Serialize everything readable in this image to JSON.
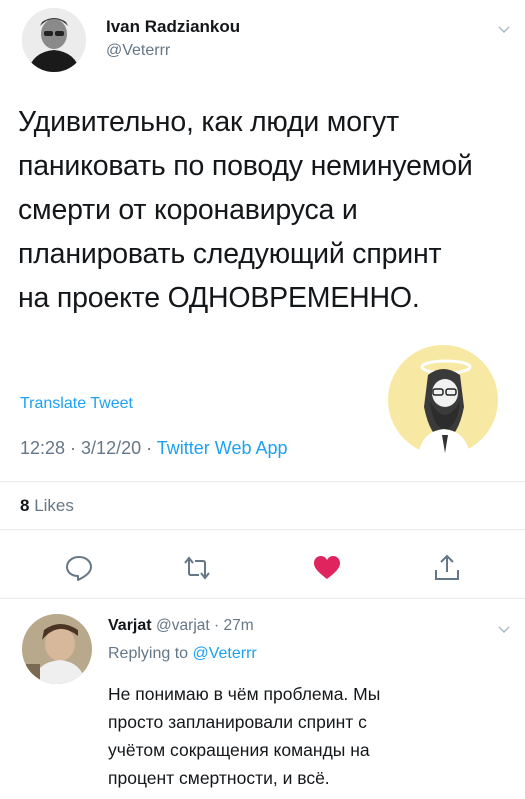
{
  "tweet": {
    "author_name": "Ivan Radziankou",
    "author_handle": "@Veterrr",
    "text_lines": [
      "Удивительно, как люди могут",
      "паниковать по поводу неминуемой",
      "смерти от коронавируса и",
      "планировать следующий спринт",
      "на проекте ОДНОВРЕМЕННО."
    ],
    "translate_label": "Translate Tweet",
    "timestamp": "12:28 · 3/12/20 · ",
    "source": "Twitter Web App",
    "likes_count": "8",
    "likes_label": "Likes"
  },
  "actions": {
    "reply_icon": "comment-icon",
    "retweet_icon": "retweet-icon",
    "like_icon": "heart-icon",
    "share_icon": "share-icon",
    "like_color": "#e0245e"
  },
  "reply": {
    "author_name": "Varjat",
    "author_handle": "@varjat · 27m",
    "replying_prefix": "Replying to ",
    "replying_to": "@Veterrr",
    "text_lines": [
      "Не понимаю в чём проблема. Мы",
      "просто запланировали спринт с",
      "учётом сокращения команды на",
      "процент смертности, и всё."
    ]
  },
  "colors": {
    "link": "#1da1f2",
    "secondary": "#657786",
    "badge_bg": "#f7e9a3"
  }
}
